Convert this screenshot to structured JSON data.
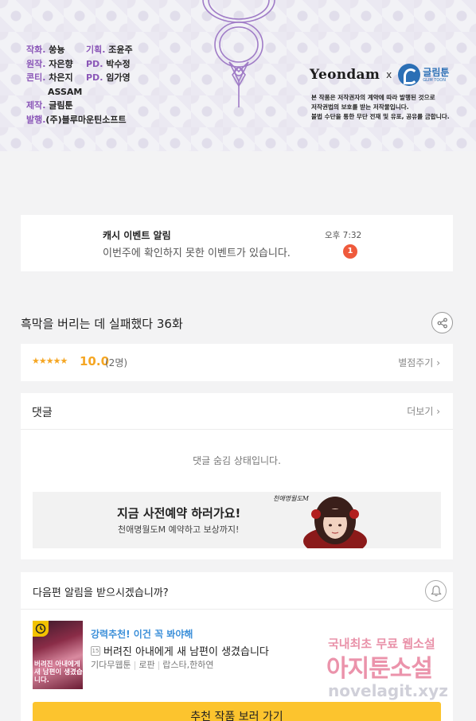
{
  "credits": {
    "left": [
      {
        "k": "작화.",
        "v": "쑹뇽"
      },
      {
        "k": "원작.",
        "v": "자은향"
      },
      {
        "k": "콘티.",
        "v": "차은지"
      },
      {
        "k": "",
        "v": "ASSAM"
      },
      {
        "k": "제작.",
        "v": "글림툰"
      },
      {
        "k": "발행.",
        "v": "(주)블루마운틴소프트"
      }
    ],
    "right": [
      {
        "k": "기획.",
        "v": "조윤주"
      },
      {
        "k": "PD.",
        "v": "박수정"
      },
      {
        "k": "PD.",
        "v": "임가영"
      }
    ],
    "brand_yeondam": "Yeondam",
    "brand_x": "x",
    "brand_glim": "글림툰",
    "brand_glim_sub": "GLIM TOON",
    "notice_lines": [
      "본 작품은 저작권자의 계약에 따라 발행된 것으로",
      "저작권법의 보호를 받는 저작물입니다.",
      "불법 수단을 통한 무단 전재 및 유포, 공유를 금합니다."
    ]
  },
  "alert": {
    "title": "캐시 이벤트 알림",
    "message": "이번주에 확인하지 못한 이벤트가 있습니다.",
    "time": "오후 7:32",
    "badge": "1"
  },
  "episode": {
    "title": "흑막을 버리는 데 실패했다 36화",
    "share_icon": "share-icon"
  },
  "rating": {
    "stars": "★★★★★",
    "score": "10.0",
    "count": "(2명)",
    "rate_label": "별점주기",
    "chevron": "›"
  },
  "comments": {
    "label": "댓글",
    "more_label": "더보기",
    "chevron": "›",
    "hidden_message": "댓글 숨김 상태입니다.",
    "promo_title": "지금 사전예약 하러가요!",
    "promo_sub": "천애명월도M 예약하고 보상까지!",
    "promo_logo": "천애명월도M"
  },
  "next": {
    "question": "다음편 알림을 받으시겠습니까?",
    "recommend_label": "강력추천! 이건 꼭 봐야해",
    "age_badge": "15",
    "work_title": "버려진 아내에게 새 남편이 생겼습니다",
    "meta": [
      "기다무웹툰",
      "로판",
      "랍스타,한하연"
    ],
    "thumb_title": "버려진 아내에게 새 남편이 생겼습니다.",
    "cta": "추천 작품 보러 가기"
  },
  "watermark": {
    "line1": "국내최초 무료 웹소설",
    "line2": "아지툰소설",
    "line3": "novelagit.xyz"
  },
  "colors": {
    "accent_purple": "#8b57b8",
    "rating_orange": "#f5a623",
    "badge_red": "#ef5a3c",
    "link_blue": "#3b8fd9",
    "cta_yellow": "#fcc42e"
  }
}
